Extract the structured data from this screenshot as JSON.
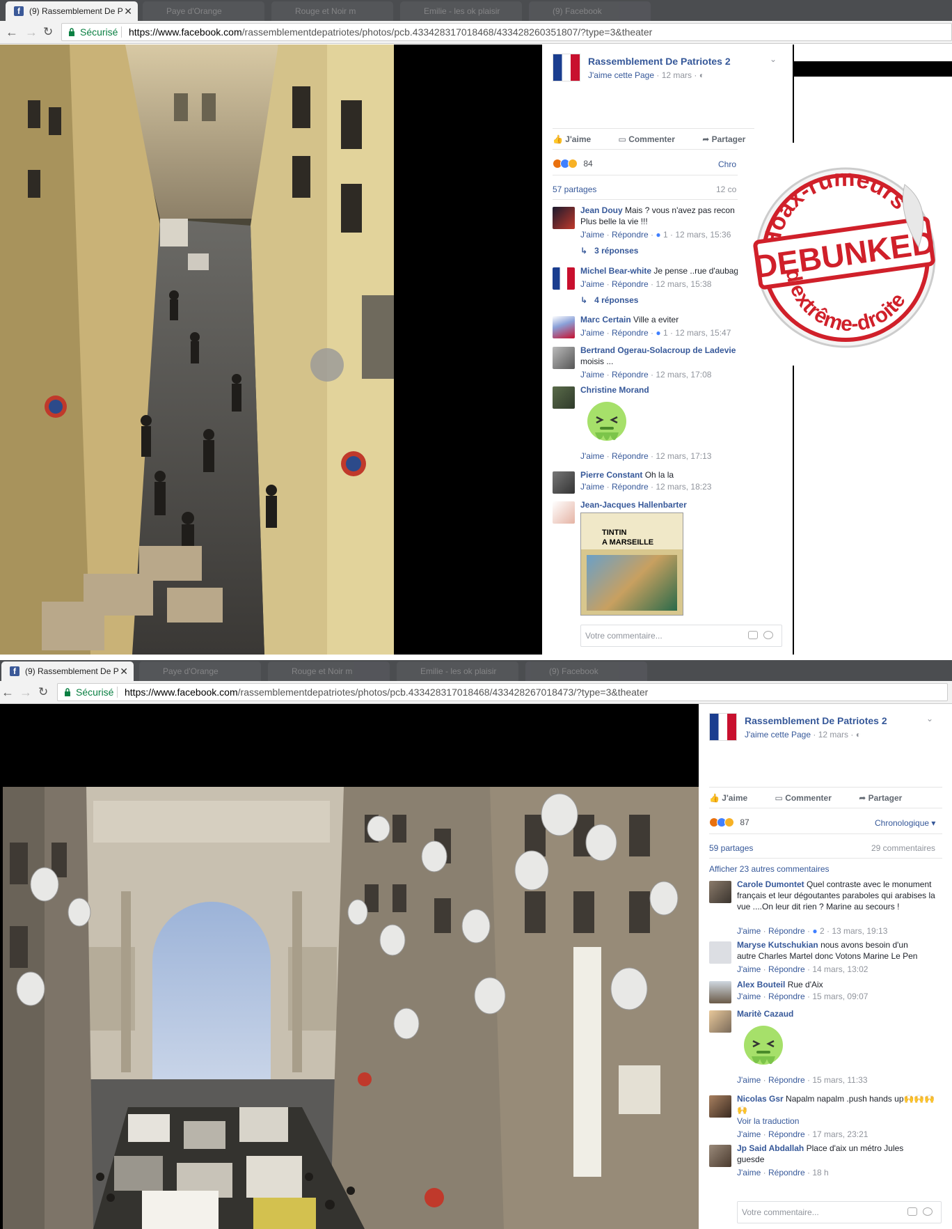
{
  "shot1": {
    "tab_active": "(9) Rassemblement De P",
    "tabs_bg": [
      "Paye d'Orange",
      "Rouge et Noir m",
      "Emilie - les ok plaisir",
      "(9) Facebook"
    ],
    "secure_label": "Sécurisé",
    "url_host": "https://www.facebook.com",
    "url_path": "/rassemblementdepatriotes/photos/pcb.433428317018468/433428260351807/?type=3&theater",
    "page": {
      "name": "Rassemblement De Patriotes 2",
      "like": "J'aime cette Page",
      "date": "12 mars"
    },
    "actions": {
      "like": "J'aime",
      "comment": "Commenter",
      "share": "Partager"
    },
    "reactions_count": "84",
    "sort": "Chro",
    "shares": "57 partages",
    "comments_count": "12 co",
    "comments": [
      {
        "author": "Jean Douy",
        "text": "Mais ? vous n'avez pas recon",
        "text2": "Plus belle la vie !!!",
        "reply": "J'aime",
        "respond": "Répondre",
        "likes": "1",
        "time": "12 mars, 15:36",
        "replies": "3 réponses"
      },
      {
        "author": "Michel Bear-white",
        "text": "Je pense ..rue d'aubag",
        "reply": "J'aime",
        "respond": "Répondre",
        "time": "12 mars, 15:38",
        "replies": "4 réponses"
      },
      {
        "author": "Marc Certain",
        "text": "Ville a eviter",
        "reply": "J'aime",
        "respond": "Répondre",
        "likes": "1",
        "time": "12 mars, 15:47"
      },
      {
        "author": "Bertrand Ogerau-Solacroup de Ladevie",
        "text": "moisis ...",
        "reply": "J'aime",
        "respond": "Répondre",
        "time": "12 mars, 17:08"
      },
      {
        "author": "Christine Morand",
        "reply": "J'aime",
        "respond": "Répondre",
        "time": "12 mars, 17:13"
      },
      {
        "author": "Pierre Constant",
        "text": "Oh la la",
        "reply": "J'aime",
        "respond": "Répondre",
        "time": "12 mars, 18:23"
      },
      {
        "author": "Jean-Jacques Hallenbarter",
        "book_title1": "TINTIN",
        "book_title2": "A MARSEILLE"
      }
    ],
    "comment_placeholder": "Votre commentaire..."
  },
  "stamp": {
    "top": "Hoax-rumeurs",
    "middle": "DEBUNKED",
    "bottom": "d'extrême-droite"
  },
  "shot2": {
    "tab_active": "(9) Rassemblement De P",
    "tabs_bg": [
      "Paye d'Orange",
      "Rouge et Noir m",
      "Emilie - les ok plaisir",
      "(9) Facebook"
    ],
    "secure_label": "Sécurisé",
    "url_host": "https://www.facebook.com",
    "url_path": "/rassemblementdepatriotes/photos/pcb.433428317018468/433428267018473/?type=3&theater",
    "page": {
      "name": "Rassemblement De Patriotes 2",
      "like": "J'aime cette Page",
      "date": "12 mars"
    },
    "actions": {
      "like": "J'aime",
      "comment": "Commenter",
      "share": "Partager"
    },
    "reactions_count": "87",
    "sort": "Chronologique",
    "shares": "59 partages",
    "comments_count": "29 commentaires",
    "more_comments": "Afficher 23 autres commentaires",
    "comments": [
      {
        "author": "Carole Dumontet",
        "text": "Quel contraste avec le monument français et leur dégoutantes paraboles qui arabises la vue ....On leur dit rien ? Marine au secours !",
        "reply": "J'aime",
        "respond": "Répondre",
        "likes": "2",
        "time": "13 mars, 19:13"
      },
      {
        "author": "Maryse Kutschukian",
        "text": "nous avons besoin d'un autre Charles Martel donc Votons Marine Le Pen",
        "reply": "J'aime",
        "respond": "Répondre",
        "time": "14 mars, 13:02"
      },
      {
        "author": "Alex Bouteil",
        "text": "Rue d'Aix",
        "reply": "J'aime",
        "respond": "Répondre",
        "time": "15 mars, 09:07"
      },
      {
        "author": "Maritè Cazaud",
        "reply": "J'aime",
        "respond": "Répondre",
        "time": "15 mars, 11:33"
      },
      {
        "author": "Nicolas Gsr",
        "text": "Napalm napalm .push hands up🙌🙌🙌🙌",
        "translate": "Voir la traduction",
        "reply": "J'aime",
        "respond": "Répondre",
        "time": "17 mars, 23:21"
      },
      {
        "author": "Jp Said Abdallah",
        "text": "Place d'aix un métro Jules guesde",
        "reply": "J'aime",
        "respond": "Répondre",
        "time": "18 h"
      }
    ],
    "comment_placeholder": "Votre commentaire..."
  },
  "colors": {
    "fb_blue": "#365899",
    "tabbar": "#4b4d50",
    "secure_green": "#0b8043",
    "stamp_red": "#d0202a"
  }
}
